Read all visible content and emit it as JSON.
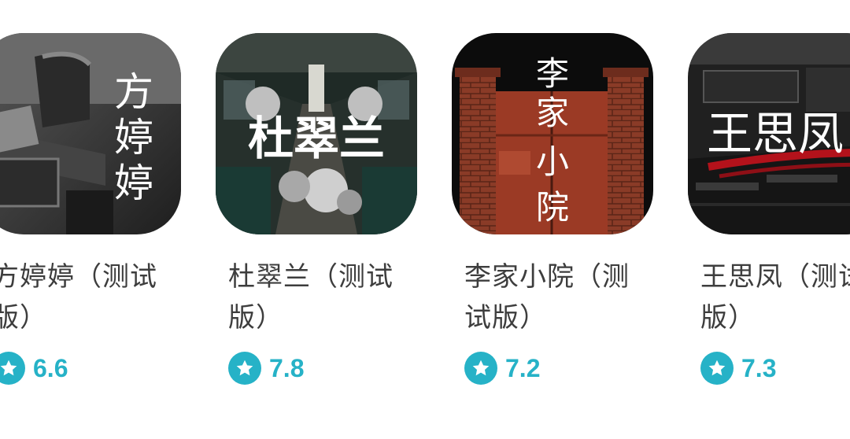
{
  "theme": {
    "accent": "#26b2c7",
    "title_color": "#3d3d3d"
  },
  "games": [
    {
      "icon_text": "方婷婷",
      "title": "方婷婷（测试版）",
      "rating": "6.6",
      "icon": "dorm-room-icon"
    },
    {
      "icon_text": "杜翠兰",
      "title": "杜翠兰（测试版）",
      "rating": "7.8",
      "icon": "train-carriage-icon"
    },
    {
      "icon_text": "李家小院",
      "title": "李家小院（测试版）",
      "rating": "7.2",
      "icon": "brick-gate-icon"
    },
    {
      "icon_text": "王思凤",
      "title": "王思凤（测试版）",
      "rating": "7.3",
      "icon": "classroom-icon"
    }
  ]
}
